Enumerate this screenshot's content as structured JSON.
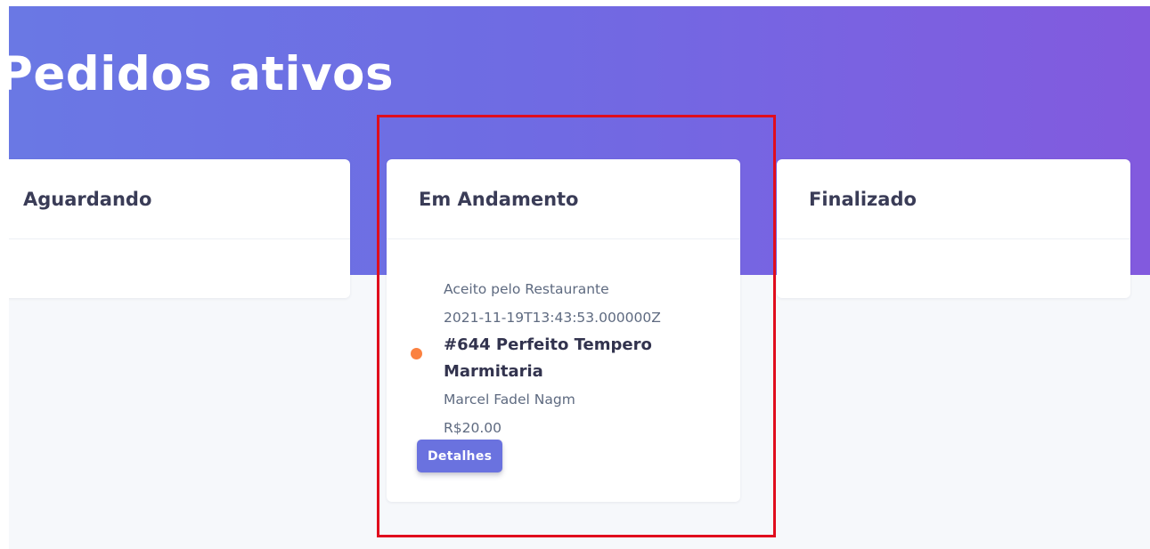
{
  "page": {
    "title": "Pedidos ativos",
    "colors": {
      "hero_gradient_start": "#6a78e4",
      "hero_gradient_end": "#825ade",
      "background": "#f6f8fb",
      "status_dot": "#fb8140",
      "button": "#6a72df",
      "highlight": "#e00d1d"
    }
  },
  "columns": [
    {
      "title": "Aguardando",
      "orders": []
    },
    {
      "title": "Em Andamento",
      "orders": [
        {
          "status": "Aceito pelo Restaurante",
          "timestamp": "2021-11-19T13:43:53.000000Z",
          "title": "#644 Perfeito Tempero Marmitaria",
          "customer": "Marcel Fadel Nagm",
          "total": "R$20.00",
          "details_label": "Detalhes",
          "status_color": "#fb8140"
        }
      ]
    },
    {
      "title": "Finalizado",
      "orders": []
    }
  ]
}
